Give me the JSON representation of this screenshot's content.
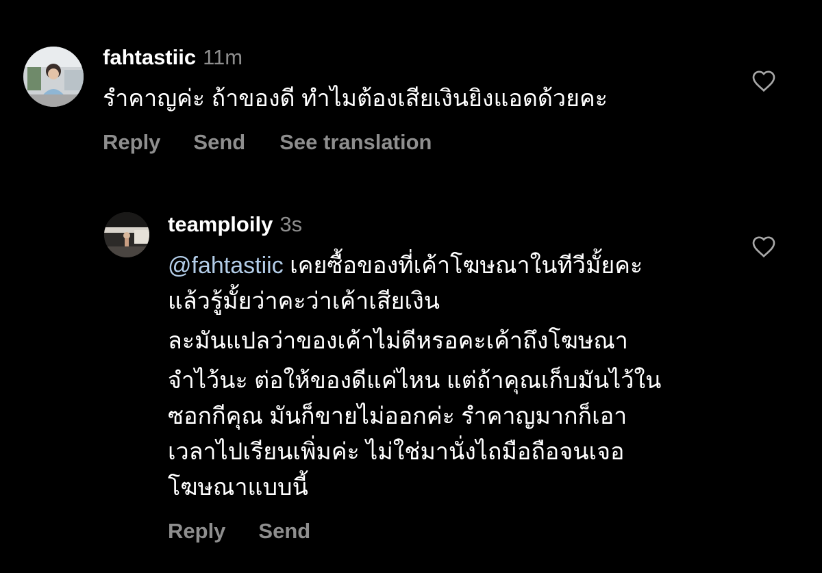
{
  "comments": [
    {
      "username": "fahtastiic",
      "time": "11m",
      "text": "รำคาญค่ะ ถ้าของดี ทำไมต้องเสียเงินยิงแอดด้วยคะ",
      "actions": [
        "Reply",
        "Send",
        "See translation"
      ]
    },
    {
      "username": "teamploily",
      "time": "3s",
      "mention": "@fahtastiic",
      "lines": [
        " เคยซื้อของที่เค้าโฆษณาในทีวีมั้ยคะ",
        "แล้วรู้มั้ยว่าคะว่าเค้าเสียเงิน",
        "ละมันแปลว่าของเค้าไม่ดีหรอคะเค้าถึงโฆษณา",
        "จำไว้นะ ต่อให้ของดีแค่ไหน แต่ถ้าคุณเก็บมันไว้ใน",
        "ซอกกีคุณ มันก็ขายไม่ออกค่ะ รำคาญมากก็เอา",
        "เวลาไปเรียนเพิ่มค่ะ ไม่ใช่มานั่งไถมือถือจนเจอ",
        "โฆษณาแบบนี้"
      ],
      "actions": [
        "Reply",
        "Send"
      ]
    }
  ],
  "icons": {
    "like": "heart-icon",
    "avatar": "avatar-photo"
  },
  "colors": {
    "background": "#000000",
    "text": "#ffffff",
    "secondary": "#8e8e8e",
    "mention": "#b3cde8"
  }
}
